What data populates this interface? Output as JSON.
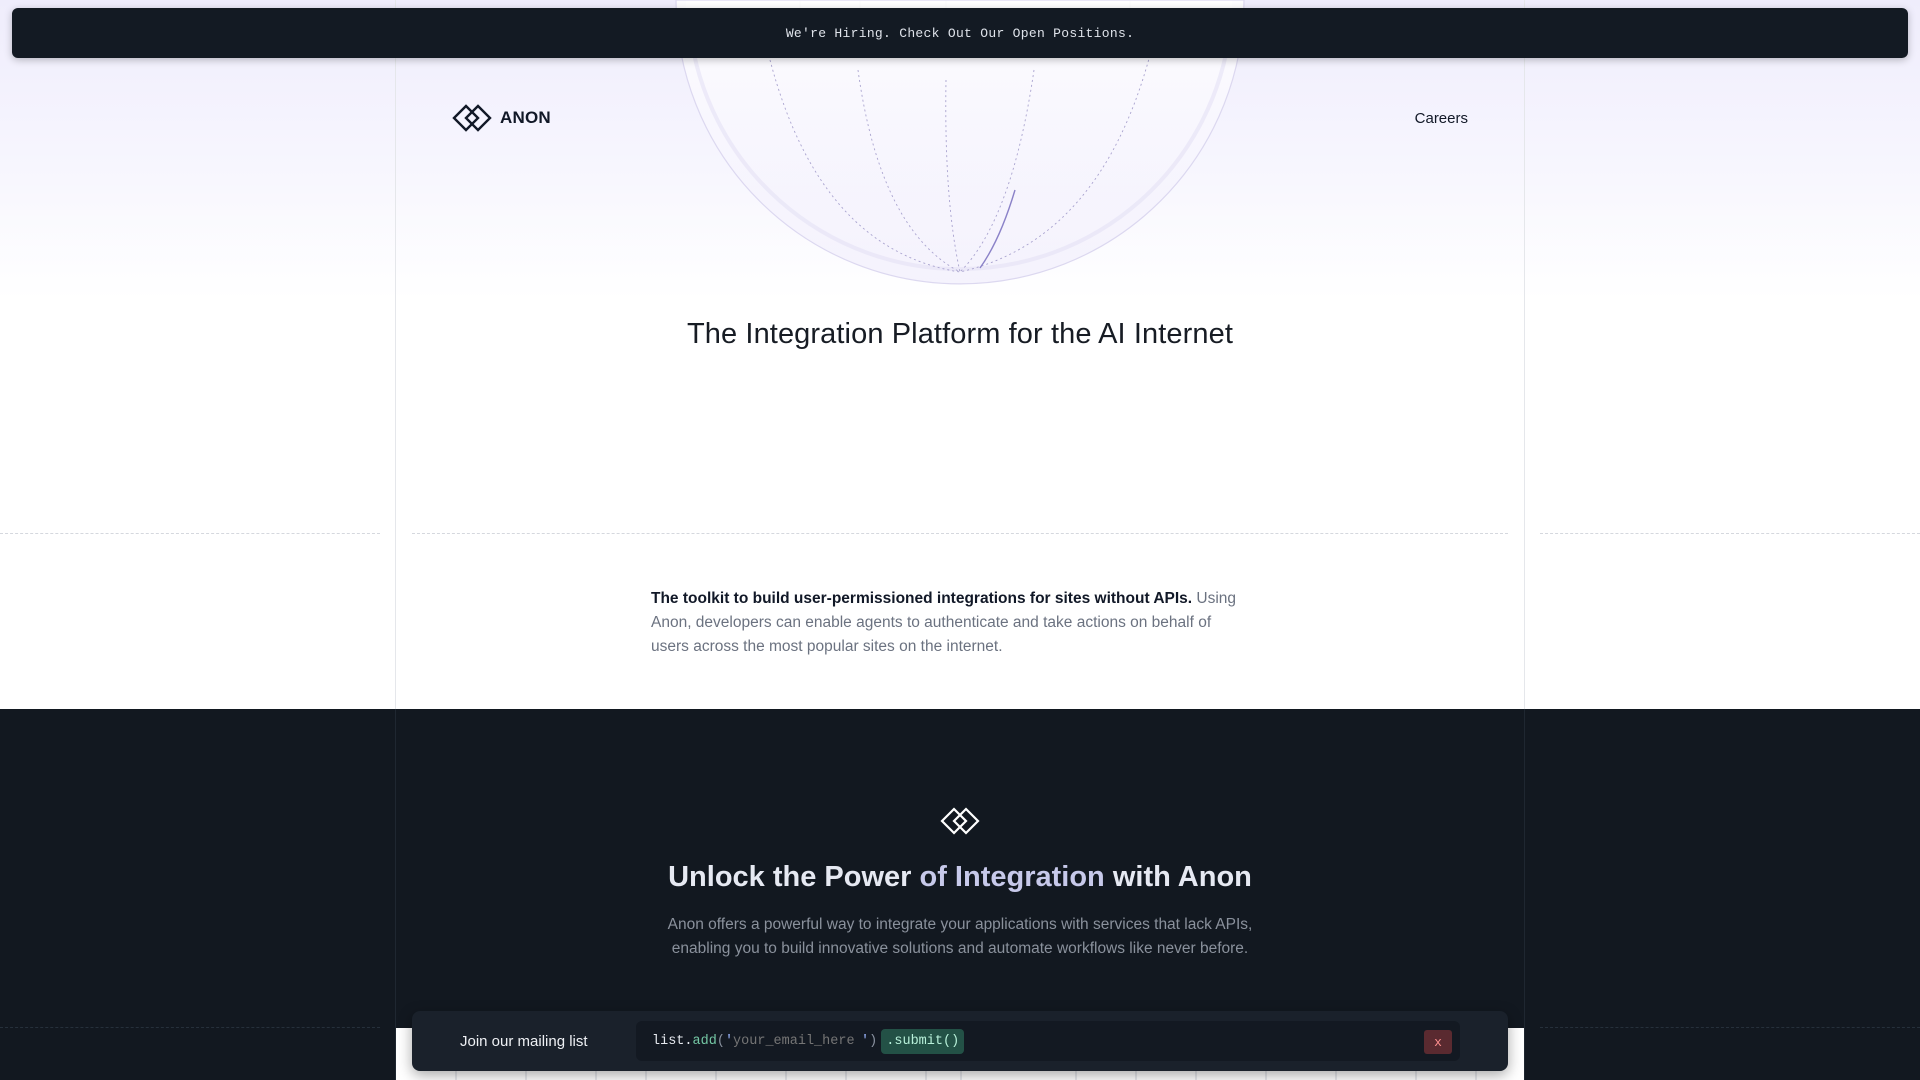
{
  "banner": {
    "text": "We're Hiring. Check Out Our Open Positions."
  },
  "nav": {
    "logo_text": "ANON",
    "careers_label": "Careers"
  },
  "hero": {
    "title": "The Integration Platform for the AI Internet"
  },
  "intro": {
    "lead": "The toolkit to build user-permissioned integrations for sites without APIs.",
    "body": "Using Anon, developers can enable agents to authenticate and take actions on behalf of users across the most popular sites on the internet."
  },
  "power": {
    "title_part1": "Unlock the Power",
    "title_part2": "of Integration",
    "title_part3": "with Anon",
    "description": "Anon offers a powerful way to integrate your applications with services that lack APIs, enabling you to build innovative solutions and automate workflows like never before."
  },
  "mailing": {
    "label": "Join our mailing list",
    "code_prefix": "list.",
    "code_fn": "add",
    "code_open": "(",
    "code_quote": "'",
    "email_placeholder": "your_email_here",
    "code_close": ")",
    "submit_label": ".submit()",
    "close_label": "x"
  },
  "colors": {
    "banner_bg": "#131a23",
    "dark_section_bg": "#121820",
    "accent_green": "#74c7a4",
    "accent_blue": "#9bb6ff",
    "close_red": "#ff8f8f"
  }
}
